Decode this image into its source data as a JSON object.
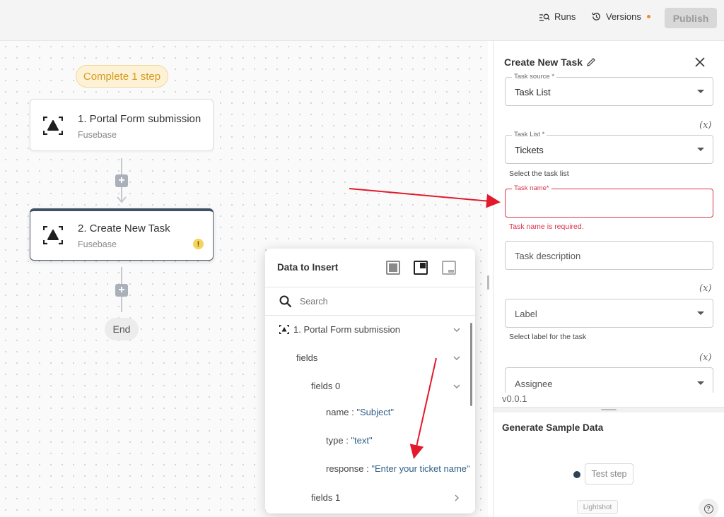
{
  "topbar": {
    "runs_label": "Runs",
    "versions_label": "Versions",
    "publish_label": "Publish"
  },
  "canvas": {
    "status_pill": "Complete 1 step",
    "nodes": [
      {
        "title": "1. Portal Form submission",
        "subtitle": "Fusebase"
      },
      {
        "title": "2. Create New Task",
        "subtitle": "Fusebase",
        "warning": "!"
      }
    ],
    "add_symbol": "+",
    "end_label": "End"
  },
  "data_insert": {
    "title": "Data to Insert",
    "search_placeholder": "Search",
    "rows": [
      {
        "label": "1. Portal Form submission"
      },
      {
        "label": "fields"
      },
      {
        "label": "fields 0"
      },
      {
        "key": "name",
        "sep": " : ",
        "value": "\"Subject\""
      },
      {
        "key": "type",
        "sep": " : ",
        "value": "\"text\""
      },
      {
        "key": "response",
        "sep": " : ",
        "value": "\"Enter your ticket name\""
      },
      {
        "label": "fields 1"
      }
    ]
  },
  "panel": {
    "title": "Create New Task",
    "fx": "(x)",
    "task_source": {
      "label": "Task source *",
      "value": "Task List"
    },
    "task_list": {
      "label": "Task List *",
      "value": "Tickets",
      "helper": "Select the task list"
    },
    "task_name": {
      "label": "Task name*",
      "value": "",
      "error": "Task name is required."
    },
    "task_description": {
      "placeholder": "Task description"
    },
    "label_field": {
      "placeholder": "Label",
      "helper": "Select label for the task"
    },
    "assignee": {
      "placeholder": "Assignee"
    },
    "version": "v0.0.1",
    "generate_title": "Generate Sample Data",
    "test_step_label": "Test step",
    "lightshot_label": "Lightshot",
    "help_symbol": "?"
  },
  "colors": {
    "error": "#d8344b",
    "annotation_arrow": "#e3192c",
    "pill_bg": "#fdf2d6",
    "pill_text": "#d59a1f"
  }
}
